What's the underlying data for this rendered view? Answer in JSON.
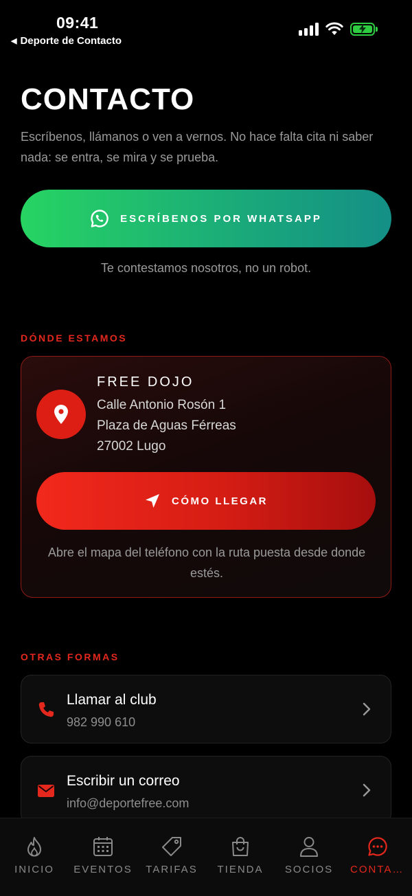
{
  "status_bar": {
    "time": "09:41",
    "back_label": "Deporte de Contacto",
    "signal_icon": "signal-bars-icon",
    "wifi_icon": "wifi-icon",
    "battery_icon": "battery-charging-icon",
    "battery_color": "#2ecc40"
  },
  "header": {
    "title": "CONTACTO",
    "intro": "Escríbenos, llámanos o ven a vernos. No hace falta cita ni saber nada: se entra, se mira y se prueba."
  },
  "whatsapp": {
    "label": "ESCRÍBENOS POR WHATSAPP",
    "note": "Te contestamos nosotros, no un robot.",
    "icon": "whatsapp-icon",
    "color": "#27d462"
  },
  "location": {
    "section_label": "DÓNDE ESTAMOS",
    "name": "FREE DOJO",
    "address_line1": "Calle Antonio Rosón 1",
    "address_line2": "Plaza de Aguas Férreas",
    "address_line3": "27002 Lugo",
    "route_label": "CÓMO LLEGAR",
    "route_note": "Abre el mapa del teléfono con la ruta puesta desde donde estés.",
    "pin_icon": "map-pin-icon",
    "route_icon": "navigation-arrow-icon",
    "accent": "#e4281d"
  },
  "other": {
    "section_label": "OTRAS FORMAS",
    "items": [
      {
        "title": "Llamar al club",
        "subtitle": "982 990 610",
        "icon": "phone-icon"
      },
      {
        "title": "Escribir un correo",
        "subtitle": "info@deportefree.com",
        "icon": "mail-icon"
      }
    ]
  },
  "tabbar": {
    "active_color": "#e4281d",
    "items": [
      {
        "label": "INICIO",
        "icon": "flame-icon"
      },
      {
        "label": "EVENTOS",
        "icon": "calendar-icon"
      },
      {
        "label": "TARIFAS",
        "icon": "tag-icon"
      },
      {
        "label": "TIENDA",
        "icon": "shopping-bag-icon"
      },
      {
        "label": "SOCIOS",
        "icon": "user-icon"
      },
      {
        "label": "CONTACTO",
        "icon": "chat-bubble-icon",
        "active": true
      }
    ]
  }
}
